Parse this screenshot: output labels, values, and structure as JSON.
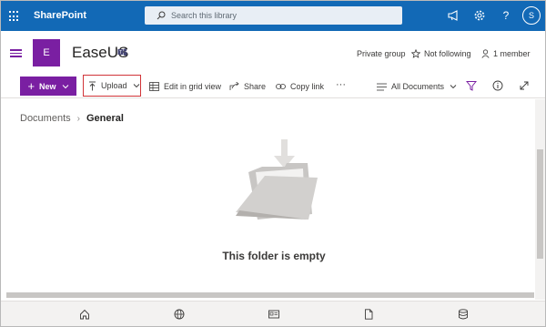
{
  "suitebar": {
    "app_name": "SharePoint",
    "search_placeholder": "Search this library",
    "avatar_initial": "S",
    "icons": [
      "waffle-icon",
      "megaphone-icon",
      "gear-icon",
      "help-icon"
    ]
  },
  "site": {
    "logo_letter": "E",
    "title": "EaseUS",
    "privacy": "Private group",
    "follow_label": "Not following",
    "members_label": "1 member"
  },
  "commands": {
    "new_label": "New",
    "upload_label": "Upload",
    "grid_label": "Edit in grid view",
    "share_label": "Share",
    "copy_link_label": "Copy link",
    "more_label": "···",
    "view_label": "All Documents"
  },
  "breadcrumb": {
    "root": "Documents",
    "current": "General"
  },
  "empty_state": {
    "message": "This folder is empty"
  },
  "colors": {
    "suitebar": "#1269b6",
    "accent": "#7a1fa2",
    "highlight": "#d13438"
  }
}
